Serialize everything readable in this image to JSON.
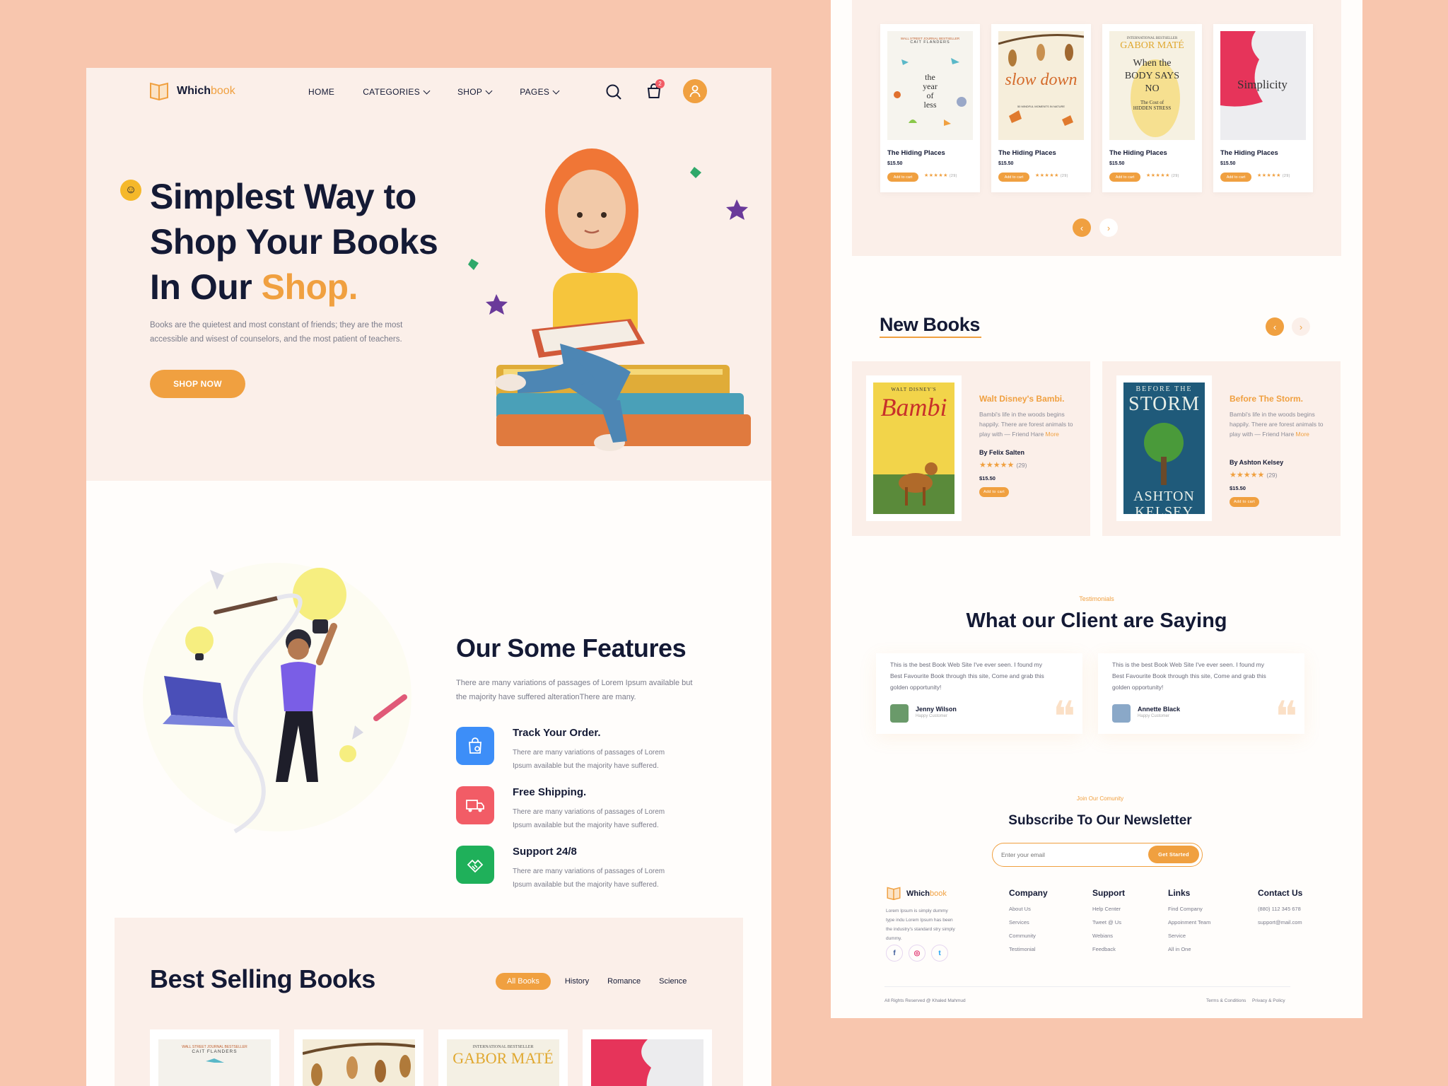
{
  "brand": {
    "name_prefix": "Which",
    "name_suffix": "book",
    "logo_icon": "open-book-icon",
    "accent": "#f0a040",
    "dark": "#141a35",
    "peach_bg": "#f8c6ae"
  },
  "nav": {
    "items": [
      {
        "label": "HOME"
      },
      {
        "label": "CATEGORIES"
      },
      {
        "label": "SHOP"
      },
      {
        "label": "PAGES"
      }
    ],
    "cart_badge": "2",
    "icons": [
      "search-icon",
      "cart-icon",
      "user-icon"
    ]
  },
  "hero": {
    "title_line1": "Simplest Way to",
    "title_line2": "Shop Your Books",
    "title_line3_prefix": "In Our ",
    "title_line3_accent": "Shop.",
    "subtitle": "Books are the quietest and most constant of friends; they are the most accessible and wisest of counselors, and the most patient of teachers.",
    "cta": "SHOP NOW"
  },
  "features": {
    "title": "Our Some Features",
    "subtitle": "There are many variations of passages of Lorem Ipsum available but the majority have suffered alterationThere are many.",
    "items": [
      {
        "title": "Track Your Order.",
        "text": "There are many variations of passages of Lorem Ipsum available but the majority have suffered.",
        "icon": "shopping-bag-location-icon",
        "color": "#3d8ef8"
      },
      {
        "title": "Free Shipping.",
        "text": "There are many variations of passages of Lorem Ipsum available but the majority have suffered.",
        "icon": "delivery-truck-icon",
        "color": "#f25c66"
      },
      {
        "title": "Support 24/8",
        "text": "There are many variations of passages of Lorem Ipsum available but the majority have suffered.",
        "icon": "support-handshake-icon",
        "color": "#1fb05a"
      }
    ]
  },
  "best_selling": {
    "title": "Best Selling Books",
    "tabs": [
      {
        "label": "All Books",
        "active": true
      },
      {
        "label": "History",
        "active": false
      },
      {
        "label": "Romance",
        "active": false
      },
      {
        "label": "Science",
        "active": false
      }
    ],
    "covers": [
      {
        "kicker": "WALL STREET JOURNAL BESTSELLER",
        "author": "CAIT FLANDERS"
      },
      {
        "kicker": "",
        "author": ""
      },
      {
        "kicker": "INTERNATIONAL BESTSELLER",
        "author": "GABOR MATÉ"
      },
      {
        "kicker": "",
        "author": ""
      }
    ]
  },
  "carousel": {
    "books": [
      {
        "title": "The Hiding Places",
        "price": "$15.50",
        "add": "Add to cart",
        "rating_count": "(29)",
        "cover_kicker": "WALL STREET JOURNAL BESTSELLER",
        "cover_author": "CAIT FLANDERS",
        "cover_title": "the year of less"
      },
      {
        "title": "The Hiding Places",
        "price": "$15.50",
        "add": "Add to cart",
        "rating_count": "(29)",
        "cover_title": "slow down",
        "cover_sub": "50 MINDFUL MOMENTS IN NATURE"
      },
      {
        "title": "The Hiding Places",
        "price": "$15.50",
        "add": "Add to cart",
        "rating_count": "(29)",
        "cover_kicker": "INTERNATIONAL BESTSELLER",
        "cover_author": "GABOR MATÉ",
        "cover_title": "When the BODY SAYS NO",
        "cover_sub": "The Cost of HIDDEN STRESS"
      },
      {
        "title": "The Hiding Places",
        "price": "$15.50",
        "add": "Add to cart",
        "rating_count": "(29)",
        "cover_title": "Simplicity"
      }
    ],
    "prev": "‹",
    "next": "›"
  },
  "new_books": {
    "title": "New Books",
    "items": [
      {
        "cover_top": "WALT DISNEY'S",
        "cover_title": "Bambi",
        "title": "Walt Disney's Bambi.",
        "desc": "Bambi's life in the woods begins happily. There are forest animals to play with — Friend Hare ",
        "more": "More",
        "by": "By Felix Salten",
        "rating": "(29)",
        "price": "$15.50",
        "add": "Add to cart"
      },
      {
        "cover_top": "BEFORE THE",
        "cover_title": "STORM",
        "cover_author": "ASHTON KELSEY",
        "title": "Before The Storm.",
        "desc": "Bambi's life in the woods begins happily. There are forest animals to play with — Friend Hare ",
        "more": "More",
        "by": "By Ashton Kelsey",
        "rating": "(29)",
        "price": "$15.50",
        "add": "Add to cart"
      }
    ]
  },
  "testimonials": {
    "kicker": "Testimonials",
    "title": "What our Client are Saying",
    "items": [
      {
        "text": "This is the best Book Web Site I've ever seen. I found my Best Favourite Book through this site, Come and grab this golden opportunity!",
        "name": "Jenny Wilson",
        "role": "Happy Customer"
      },
      {
        "text": "This is the best Book Web Site I've ever seen. I found my Best Favourite Book through this site, Come and grab this golden opportunity!",
        "name": "Annette Black",
        "role": "Happy Customer"
      }
    ]
  },
  "newsletter": {
    "kicker": "Join Our Comunity",
    "title": "Subscribe To Our Newsletter",
    "placeholder": "Enter your email",
    "button": "Get Started"
  },
  "footer": {
    "about": "Lorem Ipsum is simply dummy type indu Lorem Ipsum has been the industry's standard stry simply dummy.",
    "social": [
      {
        "label": "f",
        "icon": "facebook-icon",
        "color": "#3b5998"
      },
      {
        "label": "◎",
        "icon": "instagram-icon",
        "color": "#e1306c"
      },
      {
        "label": "t",
        "icon": "twitter-icon",
        "color": "#1da1f2"
      }
    ],
    "columns": [
      {
        "heading": "Company",
        "links": [
          "About Us",
          "Services",
          "Community",
          "Testimonial"
        ]
      },
      {
        "heading": "Support",
        "links": [
          "Help Center",
          "Tweet @ Us",
          "Webians",
          "Feedback"
        ]
      },
      {
        "heading": "Links",
        "links": [
          "Find Company",
          "Appoinment Team",
          "Service",
          "All in One"
        ]
      },
      {
        "heading": "Contact Us",
        "links": [
          "(880) 112 345 678",
          "support@mail.com"
        ]
      }
    ],
    "copyright": "All Rights Reserved @ Khaled Mahmud",
    "terms": "Terms & Conditions",
    "privacy": "Privacy & Policy"
  }
}
